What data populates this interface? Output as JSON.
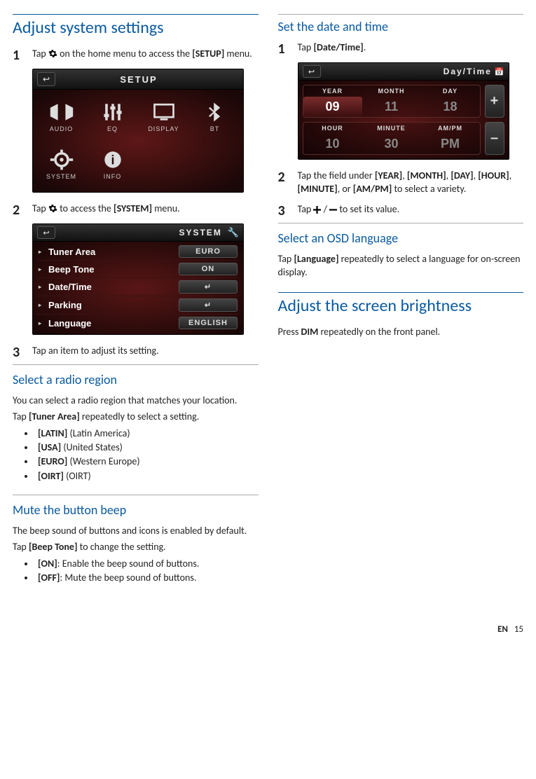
{
  "left": {
    "heading": "Adjust system settings",
    "step1_pre": "Tap ",
    "step1_post": " on the home menu to access the ",
    "step1_menu": "[SETUP]",
    "step1_end": " menu.",
    "setup_title": "SETUP",
    "setup_items": [
      "AUDIO",
      "EQ",
      "DISPLAY",
      "BT",
      "SYSTEM",
      "INFO"
    ],
    "step2_pre": "Tap ",
    "step2_post": " to access the ",
    "step2_menu": "[SYSTEM]",
    "step2_end": " menu.",
    "system_title": "SYSTEM",
    "system_rows": [
      {
        "key": "Tuner Area",
        "val": "EURO"
      },
      {
        "key": "Beep Tone",
        "val": "ON"
      },
      {
        "key": "Date/Time",
        "val": "↵"
      },
      {
        "key": "Parking",
        "val": "↵"
      },
      {
        "key": "Language",
        "val": "ENGLISH"
      }
    ],
    "step3": "Tap an item to adjust its setting.",
    "radio_heading": "Select a radio region",
    "radio_para1": "You can select a radio region that matches your location.",
    "radio_para2_pre": "Tap ",
    "radio_para2_b": "[Tuner Area]",
    "radio_para2_post": " repeatedly to select a setting.",
    "radio_opts": [
      {
        "b": "[LATIN]",
        "t": " (Latin America)"
      },
      {
        "b": "[USA]",
        "t": " (United States)"
      },
      {
        "b": "[EURO]",
        "t": " (Western Europe)"
      },
      {
        "b": "[OIRT]",
        "t": " (OIRT)"
      }
    ],
    "beep_heading": "Mute the button beep",
    "beep_para1": "The beep sound of buttons and icons is enabled by default.",
    "beep_para2_pre": "Tap ",
    "beep_para2_b": "[Beep Tone]",
    "beep_para2_post": " to change the setting.",
    "beep_opts": [
      {
        "b": "[ON]",
        "t": ": Enable the beep sound of buttons."
      },
      {
        "b": "[OFF]",
        "t": ": Mute the beep sound of buttons."
      }
    ]
  },
  "right": {
    "dt_heading": "Set the date and time",
    "dt_step1_pre": "Tap ",
    "dt_step1_b": "[Date/Time]",
    "dt_step1_post": ".",
    "dt_title": "Day/Time",
    "dt_top_labels": [
      "YEAR",
      "MONTH",
      "DAY"
    ],
    "dt_top_values": [
      "09",
      "11",
      "18"
    ],
    "dt_bot_labels": [
      "HOUR",
      "MINUTE",
      "AM/PM"
    ],
    "dt_bot_values": [
      "10",
      "30",
      "PM"
    ],
    "dt_plus": "+",
    "dt_minus": "–",
    "dt_step2_a": "Tap the field under ",
    "dt_step2_fields": [
      "[YEAR]",
      "[MONTH]",
      "[DAY]",
      "[HOUR]",
      "[MINUTE]",
      "[AM/PM]"
    ],
    "dt_step2_b": " to select a variety.",
    "dt_step3_a": "Tap ",
    "dt_step3_b": " / ",
    "dt_step3_c": " to set its value.",
    "osd_heading": "Select an OSD language",
    "osd_para_pre": "Tap ",
    "osd_para_b": "[Language]",
    "osd_para_post": " repeatedly to select a language for on-screen display.",
    "bright_heading": "Adjust the screen brightness",
    "bright_para_pre": "Press ",
    "bright_para_b": "DIM",
    "bright_para_post": " repeatedly on the front panel."
  },
  "footer_lang": "EN",
  "footer_page": "15"
}
